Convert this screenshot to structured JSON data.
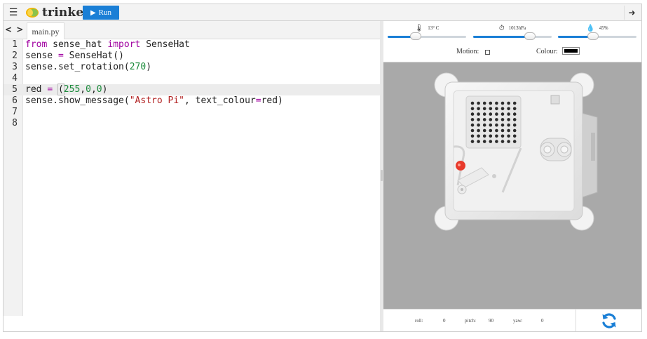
{
  "topbar": {
    "menu_icon": "hamburger-menu-icon",
    "logo_text": "trinket",
    "run_label": "Run",
    "exit_icon": "sign-in-icon"
  },
  "editor": {
    "toggle_icon": "code-toggle-icon",
    "toggle_text": "< >",
    "tab_label": "main.py",
    "active_line": 5,
    "line_numbers": [
      "1",
      "2",
      "3",
      "4",
      "5",
      "6",
      "7",
      "8"
    ],
    "lines": [
      [
        [
          "kw",
          "from"
        ],
        [
          "t",
          " sense_hat "
        ],
        [
          "kw",
          "import"
        ],
        [
          "t",
          " SenseHat"
        ]
      ],
      [
        [
          "t",
          "sense "
        ],
        [
          "op",
          "="
        ],
        [
          "t",
          " SenseHat()"
        ]
      ],
      [
        [
          "t",
          "sense.set_rotation("
        ],
        [
          "num",
          "270"
        ],
        [
          "t",
          ")"
        ]
      ],
      [],
      [
        [
          "t",
          "red "
        ],
        [
          "op",
          "="
        ],
        [
          "t",
          " "
        ],
        [
          "hl",
          "("
        ],
        [
          "num",
          "255"
        ],
        [
          "t",
          ","
        ],
        [
          "num",
          "0"
        ],
        [
          "t",
          ","
        ],
        [
          "num",
          "0"
        ],
        [
          "t",
          ")"
        ]
      ],
      [
        [
          "t",
          "sense.show_message("
        ],
        [
          "str",
          "\"Astro Pi\""
        ],
        [
          "t",
          ", text_colour"
        ],
        [
          "op",
          "="
        ],
        [
          "t",
          "red)"
        ]
      ],
      [],
      []
    ]
  },
  "sensors": {
    "temperature": {
      "label": "13° C",
      "icon": "thermometer-icon",
      "level": 0.36
    },
    "pressure": {
      "label": "1013hPa",
      "icon": "gauge-icon",
      "level": 0.72
    },
    "humidity": {
      "label": "45%",
      "icon": "water-drop-icon",
      "level": 0.45
    }
  },
  "controls": {
    "motion_label": "Motion:",
    "motion_checked": false,
    "colour_label": "Colour:",
    "colour_value": "#000000"
  },
  "orientation": {
    "roll_label": "roll:",
    "roll": "0",
    "pitch_label": "pitch:",
    "pitch": "90",
    "yaw_label": "yaw:",
    "yaw": "0"
  },
  "refresh_icon": "refresh-icon",
  "colors": {
    "accent": "#1a7fd6",
    "led_on": "#e8392b",
    "stage_bg": "#a9a9a9"
  }
}
